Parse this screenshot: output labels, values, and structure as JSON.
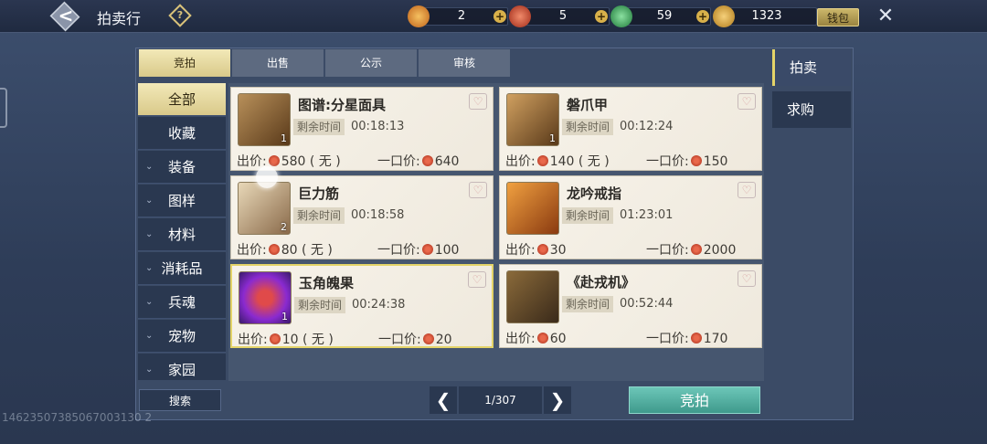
{
  "header": {
    "title": "拍卖行",
    "help_glyph": "?",
    "back_glyph": "<",
    "currencies": [
      {
        "name": "gold-coin",
        "value": "2",
        "color": "#e0882a"
      },
      {
        "name": "red-jade",
        "value": "5",
        "color": "#d0432a"
      },
      {
        "name": "green-jade",
        "value": "59",
        "color": "#35a35a"
      },
      {
        "name": "feather-token",
        "value": "1323",
        "color": "#d8a43a"
      }
    ],
    "plus_glyph": "+",
    "wallet_label": "钱包",
    "close_glyph": "✕"
  },
  "tabs": [
    "竞拍",
    "出售",
    "公示",
    "审核"
  ],
  "categories": [
    {
      "label": "全部",
      "chevron": ""
    },
    {
      "label": "收藏",
      "chevron": ""
    },
    {
      "label": "装备",
      "chevron": "⌄"
    },
    {
      "label": "图样",
      "chevron": "⌄"
    },
    {
      "label": "材料",
      "chevron": "⌄"
    },
    {
      "label": "消耗品",
      "chevron": "⌄"
    },
    {
      "label": "兵魂",
      "chevron": "⌄"
    },
    {
      "label": "宠物",
      "chevron": "⌄"
    },
    {
      "label": "家园",
      "chevron": "⌄"
    }
  ],
  "time_label": "剩余时间",
  "bid_prefix": "出价:",
  "buyout_prefix": "一口价:",
  "items": [
    {
      "name": "图谱:分星面具",
      "time": "00:18:13",
      "bid": "580 ( 无 )",
      "buyout": "640",
      "qty": "1",
      "thumb": "#7a5a38"
    },
    {
      "name": "磐爪甲",
      "time": "00:12:24",
      "bid": "140 ( 无 )",
      "buyout": "150",
      "qty": "1",
      "thumb": "#6a4a2a"
    },
    {
      "name": "巨力筋",
      "time": "00:18:58",
      "bid": "80 ( 无 )",
      "buyout": "100",
      "qty": "2",
      "thumb": "#8a6a4a"
    },
    {
      "name": "龙吟戒指",
      "time": "01:23:01",
      "bid": "30",
      "buyout": "2000",
      "qty": "",
      "thumb": "#b86a2a"
    },
    {
      "name": "玉角魄果",
      "time": "00:24:38",
      "bid": "10 ( 无 )",
      "buyout": "20",
      "qty": "1",
      "thumb": "#5a2a8a"
    },
    {
      "name": "《赴戎机》",
      "time": "00:52:44",
      "bid": "60",
      "buyout": "170",
      "qty": "",
      "thumb": "#6a4a2a"
    }
  ],
  "side_tabs": [
    "拍卖",
    "求购"
  ],
  "search_label": "搜索",
  "pager": {
    "prev": "❮",
    "page": "1/307",
    "next": "❯"
  },
  "bid_button": "竞拍",
  "watermark": "14623507385067003130 2"
}
